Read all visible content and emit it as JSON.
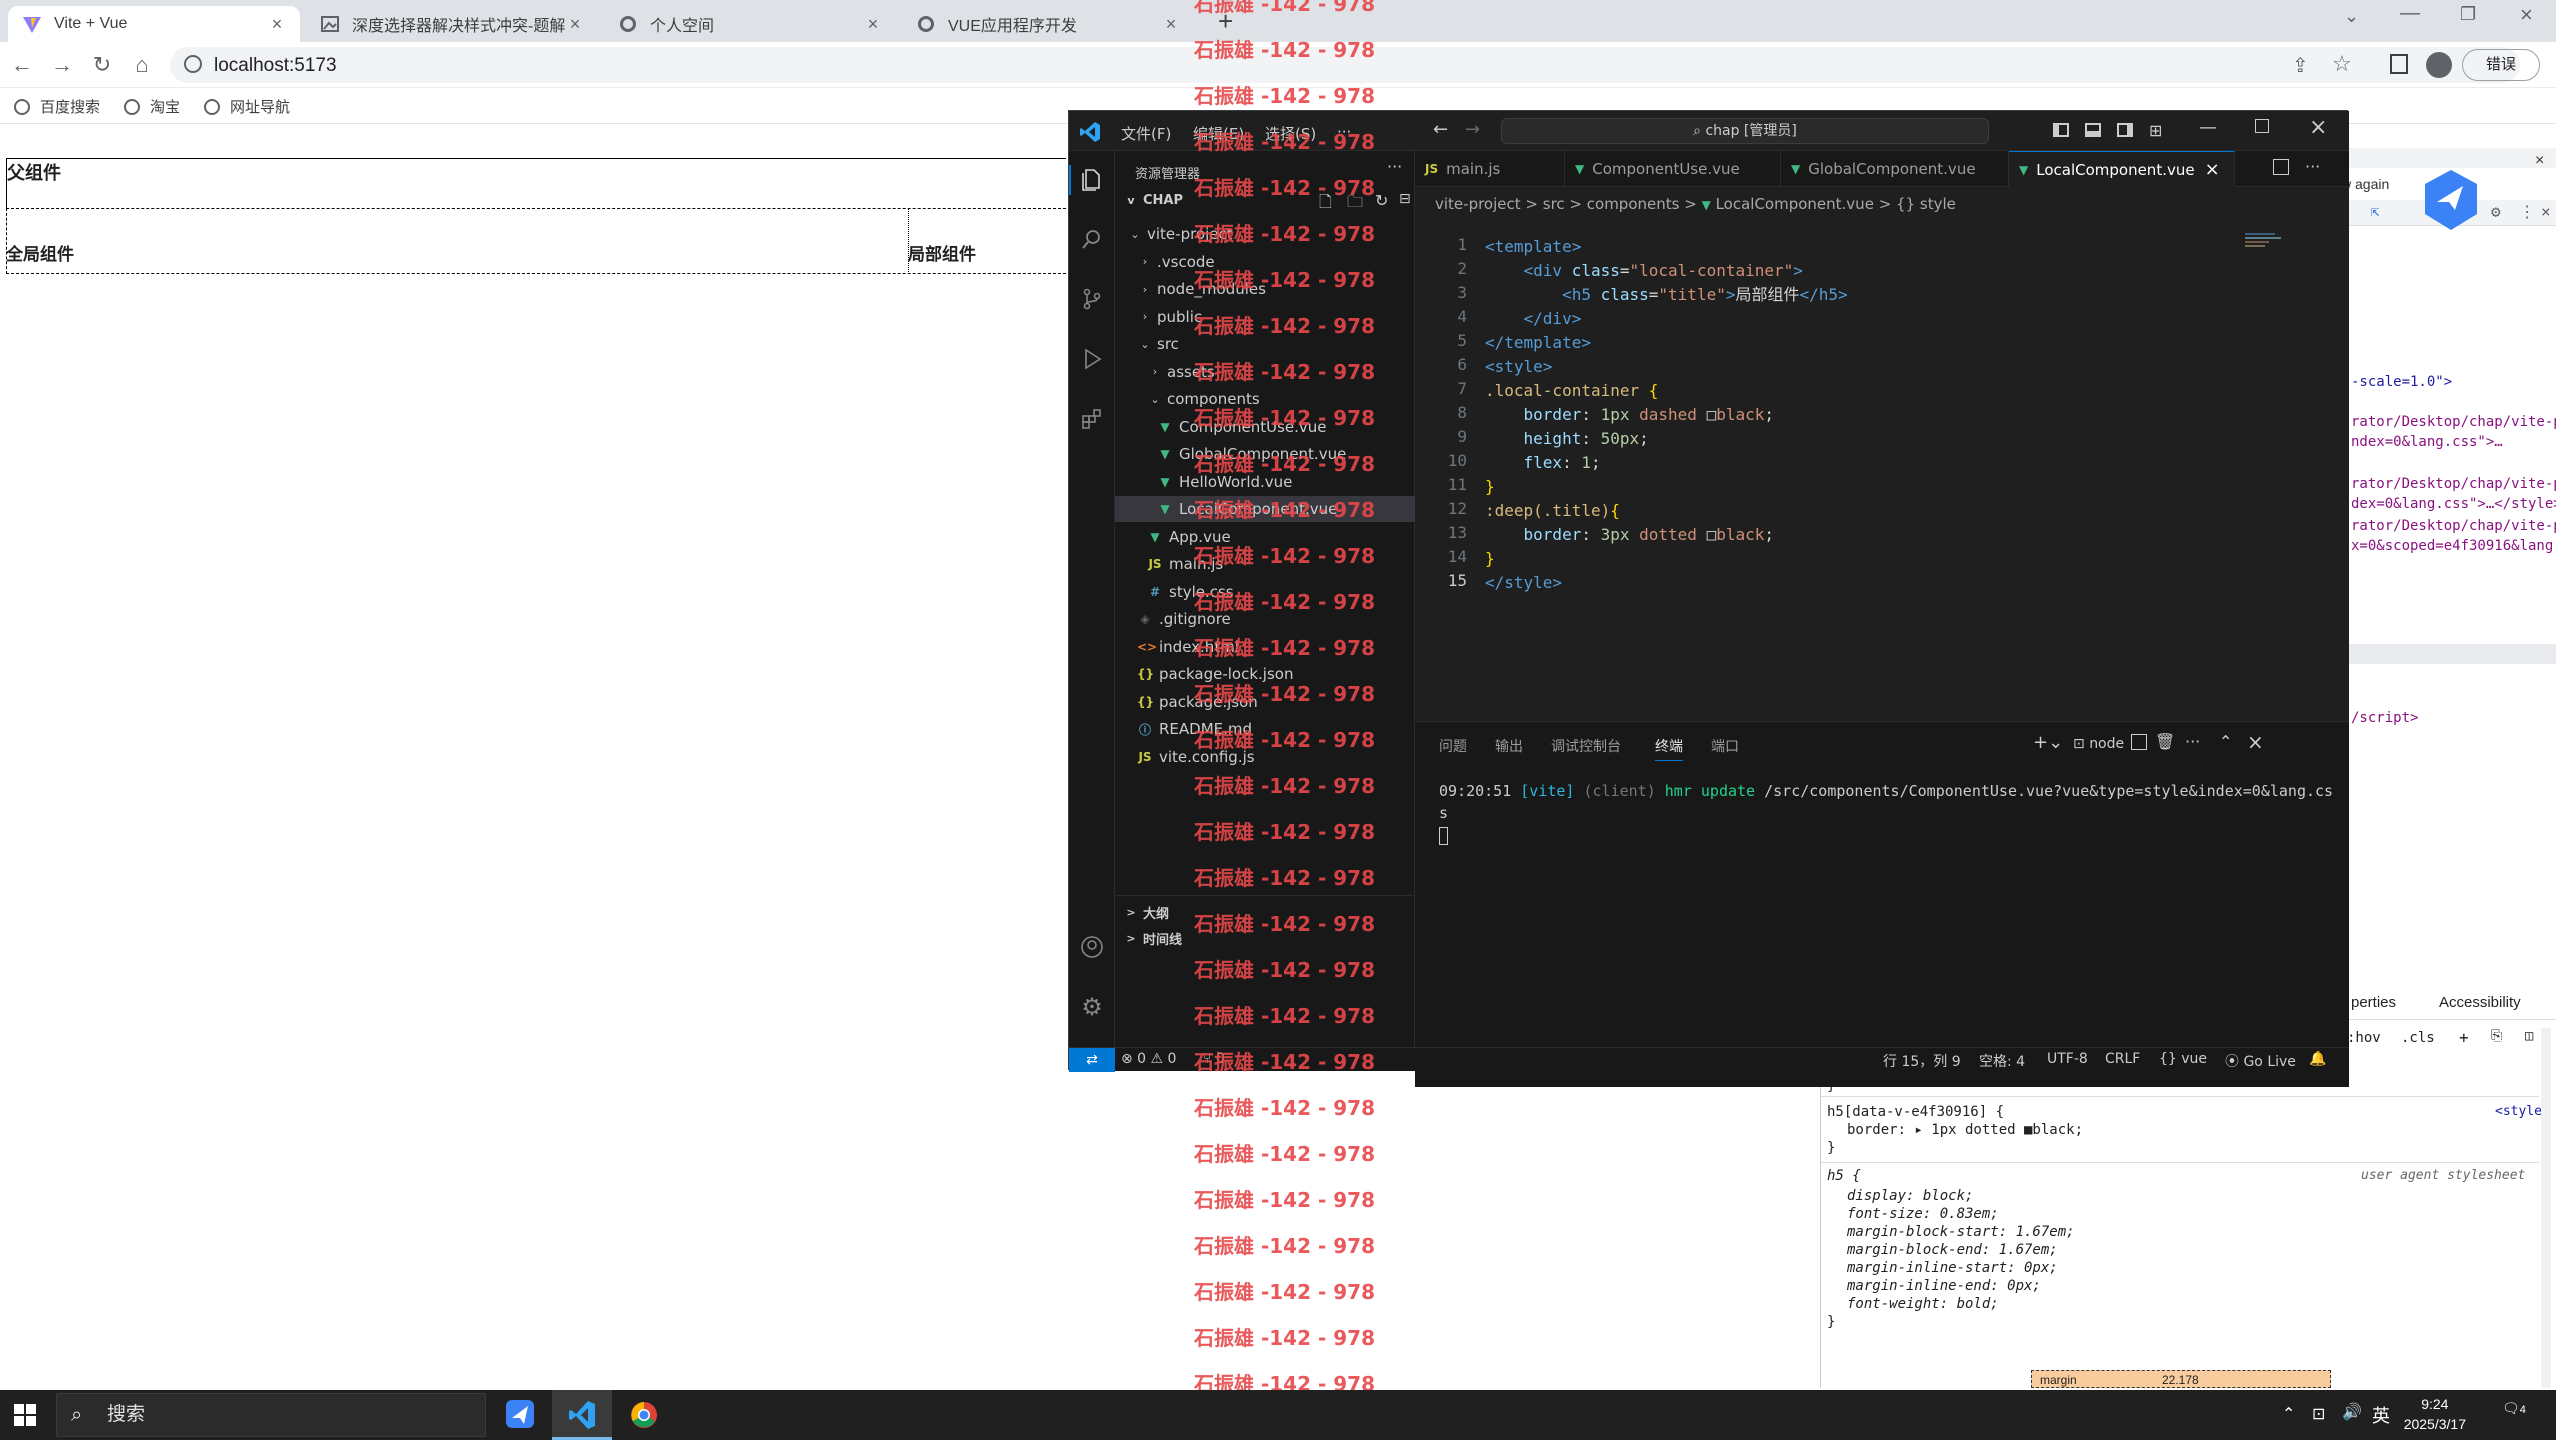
{
  "browser": {
    "tabs": [
      {
        "title": "Vite + Vue",
        "active": true
      },
      {
        "title": "深度选择器解决样式冲突-题解"
      },
      {
        "title": "个人空间"
      },
      {
        "title": "VUE应用程序开发"
      }
    ],
    "new_tab": "+",
    "url": "localhost:5173",
    "bookmarks": [
      "百度搜索",
      "淘宝",
      "网址导航"
    ],
    "error_button": "错误"
  },
  "page": {
    "parent_title": "父组件",
    "global_title": "全局组件",
    "local_title": "局部组件"
  },
  "devtools": {
    "again": "w again",
    "lines": [
      "-scale=1.0\">",
      "rator/Desktop/chap/vite-p",
      "ndex=0&lang.css\">…",
      "rator/Desktop/chap/vite-p",
      "dex=0&lang.css\">…</style>",
      "rator/Desktop/chap/vite-p",
      "x=0&scoped=e4f30916&lang.",
      "/script>"
    ],
    "props_tab": "perties",
    "accessibility_tab": "Accessibility",
    "hov": ":hov",
    "cls": ".cls",
    "rule1_close": "}",
    "rule2_selector": "h5[data-v-e4f30916] {",
    "rule2_source": "<style>",
    "rule2_prop": "border: ▸ 1px dotted ■black;",
    "rule2_close": "}",
    "rule3_selector": "h5 {",
    "rule3_source": "user agent stylesheet",
    "rule3_props": [
      "display: block;",
      "font-size: 0.83em;",
      "margin-block-start: 1.67em;",
      "margin-block-end: 1.67em;",
      "margin-inline-start: 0px;",
      "margin-inline-end: 0px;",
      "font-weight: bold;"
    ],
    "rule3_close": "}",
    "box_margin": "margin",
    "box_value": "22.178"
  },
  "vscode": {
    "menu": [
      "文件(F)",
      "编辑(E)",
      "选择(S)",
      "···"
    ],
    "search": "chap [管理员]",
    "explorer_title": "资源管理器",
    "root": "CHAP",
    "tree": [
      {
        "label": "vite-project",
        "depth": 0,
        "chev": "v"
      },
      {
        "label": ".vscode",
        "depth": 1,
        "chev": ">"
      },
      {
        "label": "node_modules",
        "depth": 1,
        "chev": ">"
      },
      {
        "label": "public",
        "depth": 1,
        "chev": ">"
      },
      {
        "label": "src",
        "depth": 1,
        "chev": "v"
      },
      {
        "label": "assets",
        "depth": 2,
        "chev": ">"
      },
      {
        "label": "components",
        "depth": 2,
        "chev": "v"
      },
      {
        "label": "ComponentUse.vue",
        "depth": 3,
        "type": "vue"
      },
      {
        "label": "GlobalComponent.vue",
        "depth": 3,
        "type": "vue"
      },
      {
        "label": "HelloWorld.vue",
        "depth": 3,
        "type": "vue"
      },
      {
        "label": "LocalComponent.vue",
        "depth": 3,
        "type": "vue",
        "selected": true
      },
      {
        "label": "App.vue",
        "depth": 2,
        "type": "vue"
      },
      {
        "label": "main.js",
        "depth": 2,
        "type": "js"
      },
      {
        "label": "style.css",
        "depth": 2,
        "type": "css"
      },
      {
        "label": ".gitignore",
        "depth": 1,
        "type": "git"
      },
      {
        "label": "index.html",
        "depth": 1,
        "type": "html"
      },
      {
        "label": "package-lock.json",
        "depth": 1,
        "type": "json"
      },
      {
        "label": "package.json",
        "depth": 1,
        "type": "json"
      },
      {
        "label": "README.md",
        "depth": 1,
        "type": "info"
      },
      {
        "label": "vite.config.js",
        "depth": 1,
        "type": "js"
      }
    ],
    "outline": "大纲",
    "timeline": "时间线",
    "tabs": [
      {
        "label": "main.js",
        "type": "js"
      },
      {
        "label": "ComponentUse.vue",
        "type": "vue"
      },
      {
        "label": "GlobalComponent.vue",
        "type": "vue"
      },
      {
        "label": "LocalComponent.vue",
        "type": "vue",
        "active": true
      }
    ],
    "breadcrumb": [
      "vite-project",
      "src",
      "components",
      "LocalComponent.vue",
      "{} style"
    ],
    "code": [
      [
        [
          "tk-tag",
          "<template>"
        ]
      ],
      [
        [
          "tk-txt",
          "    "
        ],
        [
          "tk-tag",
          "<div "
        ],
        [
          "tk-attr",
          "class"
        ],
        [
          "tk-txt",
          "="
        ],
        [
          "tk-str",
          "\"local-container\""
        ],
        [
          "tk-tag",
          ">"
        ]
      ],
      [
        [
          "tk-txt",
          "        "
        ],
        [
          "tk-tag",
          "<h5 "
        ],
        [
          "tk-attr",
          "class"
        ],
        [
          "tk-txt",
          "="
        ],
        [
          "tk-str",
          "\"title\""
        ],
        [
          "tk-tag",
          ">"
        ],
        [
          "tk-txt",
          "局部组件"
        ],
        [
          "tk-tag",
          "</h5>"
        ]
      ],
      [
        [
          "tk-txt",
          "    "
        ],
        [
          "tk-tag",
          "</div>"
        ]
      ],
      [
        [
          "tk-tag",
          "</template>"
        ]
      ],
      [
        [
          "tk-tag",
          "<style>"
        ]
      ],
      [
        [
          "tk-sel",
          ".local-container "
        ],
        [
          "tk-br",
          "{"
        ]
      ],
      [
        [
          "tk-txt",
          "    "
        ],
        [
          "tk-prop",
          "border"
        ],
        [
          "tk-txt",
          ": "
        ],
        [
          "tk-num",
          "1px"
        ],
        [
          "tk-val",
          " dashed "
        ],
        [
          "tk-txt",
          "□"
        ],
        [
          "tk-val",
          "black"
        ],
        [
          "tk-txt",
          ";"
        ]
      ],
      [
        [
          "tk-txt",
          "    "
        ],
        [
          "tk-prop",
          "height"
        ],
        [
          "tk-txt",
          ": "
        ],
        [
          "tk-num",
          "50px"
        ],
        [
          "tk-txt",
          ";"
        ]
      ],
      [
        [
          "tk-txt",
          "    "
        ],
        [
          "tk-prop",
          "flex"
        ],
        [
          "tk-txt",
          ": "
        ],
        [
          "tk-num",
          "1"
        ],
        [
          "tk-txt",
          ";"
        ]
      ],
      [
        [
          "tk-br",
          "}"
        ]
      ],
      [
        [
          "tk-sel",
          ":deep(.title)"
        ],
        [
          "tk-br",
          "{"
        ]
      ],
      [
        [
          "tk-txt",
          "    "
        ],
        [
          "tk-prop",
          "border"
        ],
        [
          "tk-txt",
          ": "
        ],
        [
          "tk-num",
          "3px"
        ],
        [
          "tk-val",
          " dotted "
        ],
        [
          "tk-txt",
          "□"
        ],
        [
          "tk-val",
          "black"
        ],
        [
          "tk-txt",
          ";"
        ]
      ],
      [
        [
          "tk-br",
          "}"
        ]
      ],
      [
        [
          "tk-tag",
          "</style>"
        ]
      ]
    ],
    "panel_tabs": [
      "问题",
      "输出",
      "调试控制台",
      "终端",
      "端口"
    ],
    "panel_active": "终端",
    "terminal_shell": "node",
    "terminal": {
      "time": "09:20:51 ",
      "tag": "[vite]",
      "client": " (client) ",
      "hmr": "hmr update ",
      "path": "/src/components/ComponentUse.vue?vue&type=style&index=0&lang.css"
    },
    "status": {
      "errors": "⊗ 0 ⚠ 0",
      "ports": "⑂ 0",
      "position": "行 15，列 9",
      "spaces": "空格: 4",
      "encoding": "UTF-8",
      "eol": "CRLF",
      "lang": "{} vue",
      "golive": "Go Live"
    }
  },
  "watermark": "石振雄 -142 - 978",
  "taskbar": {
    "search": "搜索",
    "lang": "英",
    "time": "9:24",
    "date": "2025/3/17",
    "notif": "4"
  }
}
